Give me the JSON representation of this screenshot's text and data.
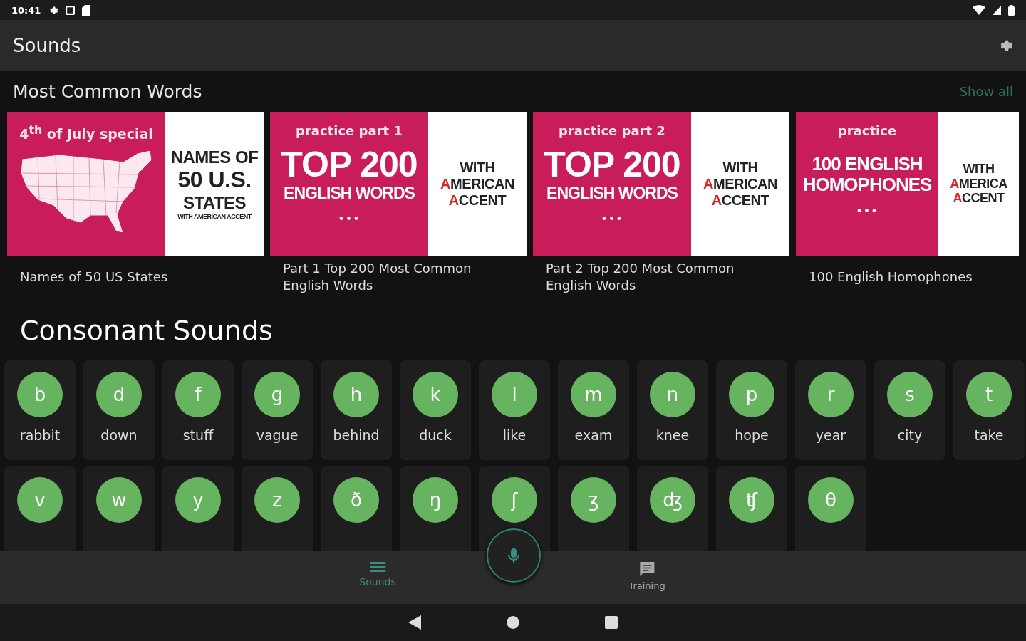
{
  "status_bar": {
    "time": "10:41"
  },
  "app_bar": {
    "title": "Sounds"
  },
  "featured": {
    "title": "Most Common Words",
    "action": "Show all",
    "items": [
      {
        "kind": "map",
        "tagline": "4$^{th}$ of July special",
        "side": [
          "NAMES OF",
          "50 U.S.",
          "STATES",
          "WITH AMERICAN ACCENT"
        ],
        "caption": "Names of 50 US States"
      },
      {
        "kind": "title",
        "tagline": "practice part 1",
        "headline": [
          "TOP 200",
          "ENGLISH WORDS"
        ],
        "dots": "•••",
        "side": [
          "WITH",
          "AMERICAN",
          "ACCENT"
        ],
        "caption": "Part 1 Top 200 Most Common English Words"
      },
      {
        "kind": "title",
        "tagline": "practice part 2",
        "headline": [
          "TOP 200",
          "ENGLISH WORDS"
        ],
        "dots": "•••",
        "side": [
          "WITH",
          "AMERICAN",
          "ACCENT"
        ],
        "caption": "Part 2 Top 200 Most Common English Words"
      },
      {
        "kind": "title",
        "tagline": "practice",
        "headline": [
          "100 ENGLISH",
          "HOMOPHONES"
        ],
        "dots": "•••",
        "side": [
          "WITH",
          "AMERICA",
          "ACCENT"
        ],
        "caption": "100 English Homophones"
      }
    ]
  },
  "consonants": {
    "title": "Consonant Sounds",
    "sounds": [
      {
        "symbol": "b",
        "word": "rabbit"
      },
      {
        "symbol": "d",
        "word": "down"
      },
      {
        "symbol": "f",
        "word": "stuff"
      },
      {
        "symbol": "g",
        "word": "vague"
      },
      {
        "symbol": "h",
        "word": "behind"
      },
      {
        "symbol": "k",
        "word": "duck"
      },
      {
        "symbol": "l",
        "word": "like"
      },
      {
        "symbol": "m",
        "word": "exam"
      },
      {
        "symbol": "n",
        "word": "knee"
      },
      {
        "symbol": "p",
        "word": "hope"
      },
      {
        "symbol": "r",
        "word": "year"
      },
      {
        "symbol": "s",
        "word": "city"
      },
      {
        "symbol": "t",
        "word": "take"
      },
      {
        "symbol": "v"
      },
      {
        "symbol": "w"
      },
      {
        "symbol": "y"
      },
      {
        "symbol": "z"
      },
      {
        "symbol": "ð"
      },
      {
        "symbol": "ŋ"
      },
      {
        "symbol": "ʃ"
      },
      {
        "symbol": "ʒ"
      },
      {
        "symbol": "ʤ"
      },
      {
        "symbol": "ʧ"
      },
      {
        "symbol": "θ"
      }
    ]
  },
  "bottom_nav": [
    {
      "label": "Sounds",
      "selected": true
    },
    {
      "label": "Training",
      "selected": false
    }
  ]
}
